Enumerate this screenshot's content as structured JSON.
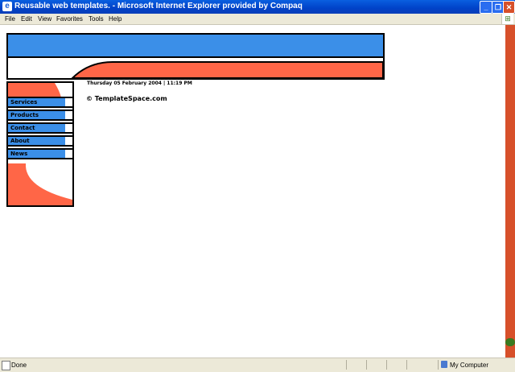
{
  "window": {
    "title": "Reusable web templates. - Microsoft Internet Explorer provided by Compaq",
    "icon": "ie-icon"
  },
  "menu": {
    "items": [
      "File",
      "Edit",
      "View",
      "Favorites",
      "Tools",
      "Help"
    ]
  },
  "page": {
    "date_line": "Thursday 05 February 2004 | 11:19 PM",
    "copyright": "© TemplateSpace.com",
    "nav": [
      "Services",
      "Products",
      "Contact",
      "About",
      "News"
    ]
  },
  "status": {
    "left": "Done",
    "zone": "My Computer"
  },
  "colors": {
    "blue": "#3b8fe8",
    "coral": "#ff6647",
    "titlebar": "#0042c8",
    "chrome": "#ece9d8"
  }
}
